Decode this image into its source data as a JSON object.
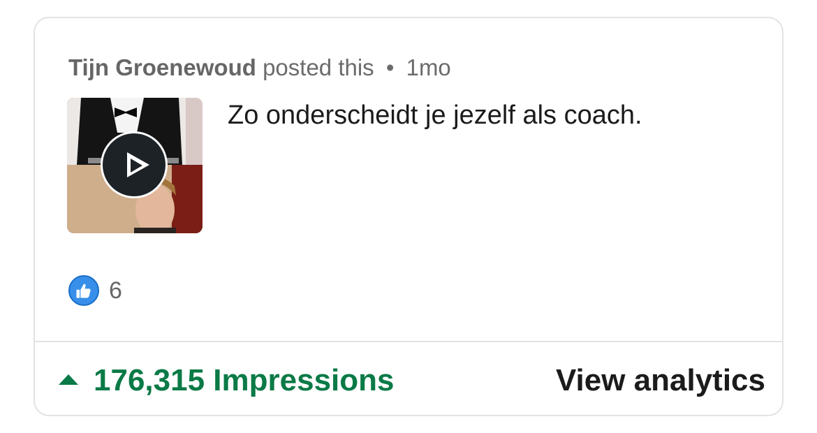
{
  "post": {
    "author": "Tijn Groenewoud",
    "action": "posted this",
    "separator": "•",
    "time": "1mo",
    "text": "Zo onderscheidt je jezelf als coach.",
    "thumbnail_icon": "play-icon"
  },
  "reactions": {
    "icon": "like-icon",
    "count": "6"
  },
  "footer": {
    "impressions_icon": "up-arrow-icon",
    "impressions_label": "176,315 Impressions",
    "analytics_label": "View analytics"
  },
  "colors": {
    "impressions": "#0a7a46",
    "like": "#378fe9",
    "border": "#e2e2e2"
  }
}
